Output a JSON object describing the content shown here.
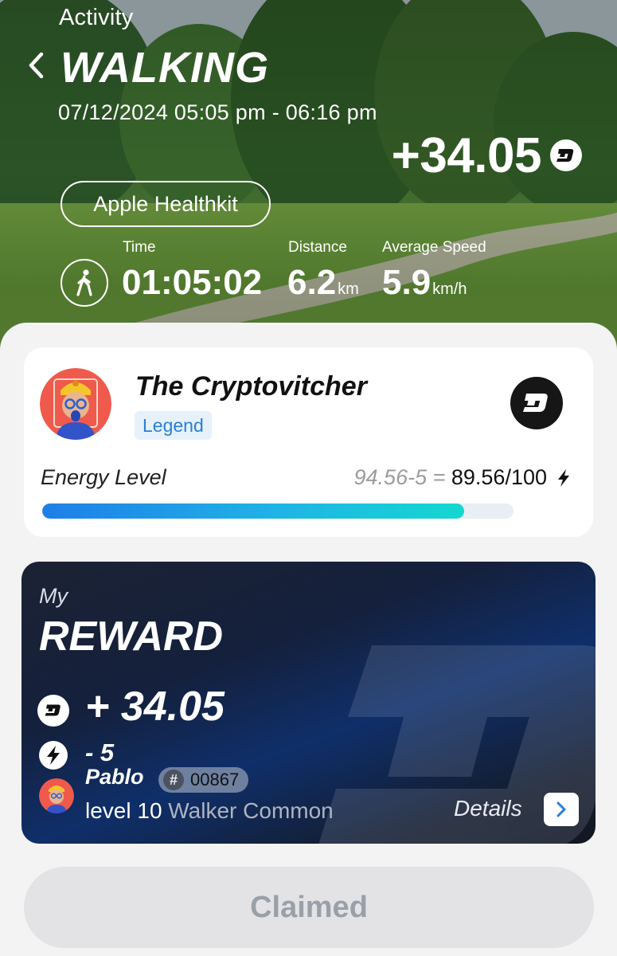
{
  "header": {
    "section_label": "Activity",
    "title": "WALKING",
    "date_range": "07/12/2024 05:05 pm - 06:16 pm",
    "earned": "+34.05",
    "source": "Apple Healthkit"
  },
  "stats": {
    "time_label": "Time",
    "time_value": "01:05:02",
    "distance_label": "Distance",
    "distance_value": "6.2",
    "distance_unit": "km",
    "speed_label": "Average Speed",
    "speed_value": "5.9",
    "speed_unit": "km/h"
  },
  "profile": {
    "name": "The Cryptovitcher",
    "rank": "Legend",
    "energy_label": "Energy Level",
    "energy_calc": "94.56-5 =",
    "energy_result": "89.56/100",
    "energy_fraction": 0.8956
  },
  "reward": {
    "my_label": "My",
    "title": "REWARD",
    "amount": "+ 34.05",
    "energy_cost": "- 5",
    "pet_name": "Pablo",
    "pet_id_symbol": "#",
    "pet_id": "00867",
    "pet_level": "level 10",
    "pet_class": "Walker Common",
    "details_label": "Details"
  },
  "claim": {
    "label": "Claimed"
  },
  "colors": {
    "accent_blue": "#2b7fd3",
    "energy_gradient_start": "#1f7ee8",
    "energy_gradient_end": "#14d8d0",
    "reward_card_bg": "#14203c",
    "claim_disabled_bg": "#e3e3e5"
  },
  "icons": {
    "back": "chevron-left-icon",
    "coin": "dash-coin-icon",
    "walk": "walking-person-icon",
    "bolt": "lightning-bolt-icon",
    "details": "chevron-right-icon"
  }
}
